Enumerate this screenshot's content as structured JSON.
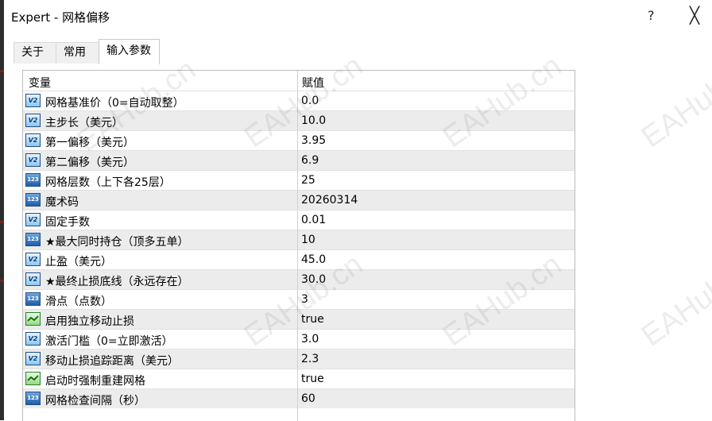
{
  "window": {
    "title": "Expert - 网格偏移",
    "help": "?",
    "close": "╳"
  },
  "tabs": [
    {
      "label": "关于",
      "active": false
    },
    {
      "label": "常用",
      "active": false
    },
    {
      "label": "输入参数",
      "active": true
    }
  ],
  "grid": {
    "col_variable": "变量",
    "col_value": "赋值",
    "rows": [
      {
        "type": "real",
        "name": "网格基准价（0=自动取整）",
        "value": "0.0"
      },
      {
        "type": "real",
        "name": "主步长（美元）",
        "value": "10.0"
      },
      {
        "type": "real",
        "name": "第一偏移（美元）",
        "value": "3.95"
      },
      {
        "type": "real",
        "name": "第二偏移（美元）",
        "value": "6.9"
      },
      {
        "type": "int",
        "name": "网格层数（上下各25层）",
        "value": "25"
      },
      {
        "type": "int",
        "name": "魔术码",
        "value": "20260314"
      },
      {
        "type": "real",
        "name": "固定手数",
        "value": "0.01"
      },
      {
        "type": "int",
        "name": "★最大同时持仓（顶多五单）",
        "value": "10"
      },
      {
        "type": "real",
        "name": "止盈（美元）",
        "value": "45.0"
      },
      {
        "type": "real",
        "name": "★最终止损底线（永远存在）",
        "value": "30.0"
      },
      {
        "type": "int",
        "name": "滑点（点数）",
        "value": "3"
      },
      {
        "type": "bool",
        "name": "启用独立移动止损",
        "value": "true"
      },
      {
        "type": "real",
        "name": "激活门槛（0=立即激活）",
        "value": "3.0"
      },
      {
        "type": "real",
        "name": "移动止损追踪距离（美元）",
        "value": "2.3"
      },
      {
        "type": "bool",
        "name": "启动时强制重建网格",
        "value": "true"
      },
      {
        "type": "int",
        "name": "网格检查间隔（秒）",
        "value": "60"
      }
    ]
  },
  "icons": {
    "real": "V2",
    "int": "123",
    "bool": "bool-check-icon"
  },
  "watermark": "EAHub.cn",
  "colors": {
    "alt_row": "#ececec",
    "icon_blue": "#1f5ea8",
    "icon_green": "#8fdd7f"
  }
}
